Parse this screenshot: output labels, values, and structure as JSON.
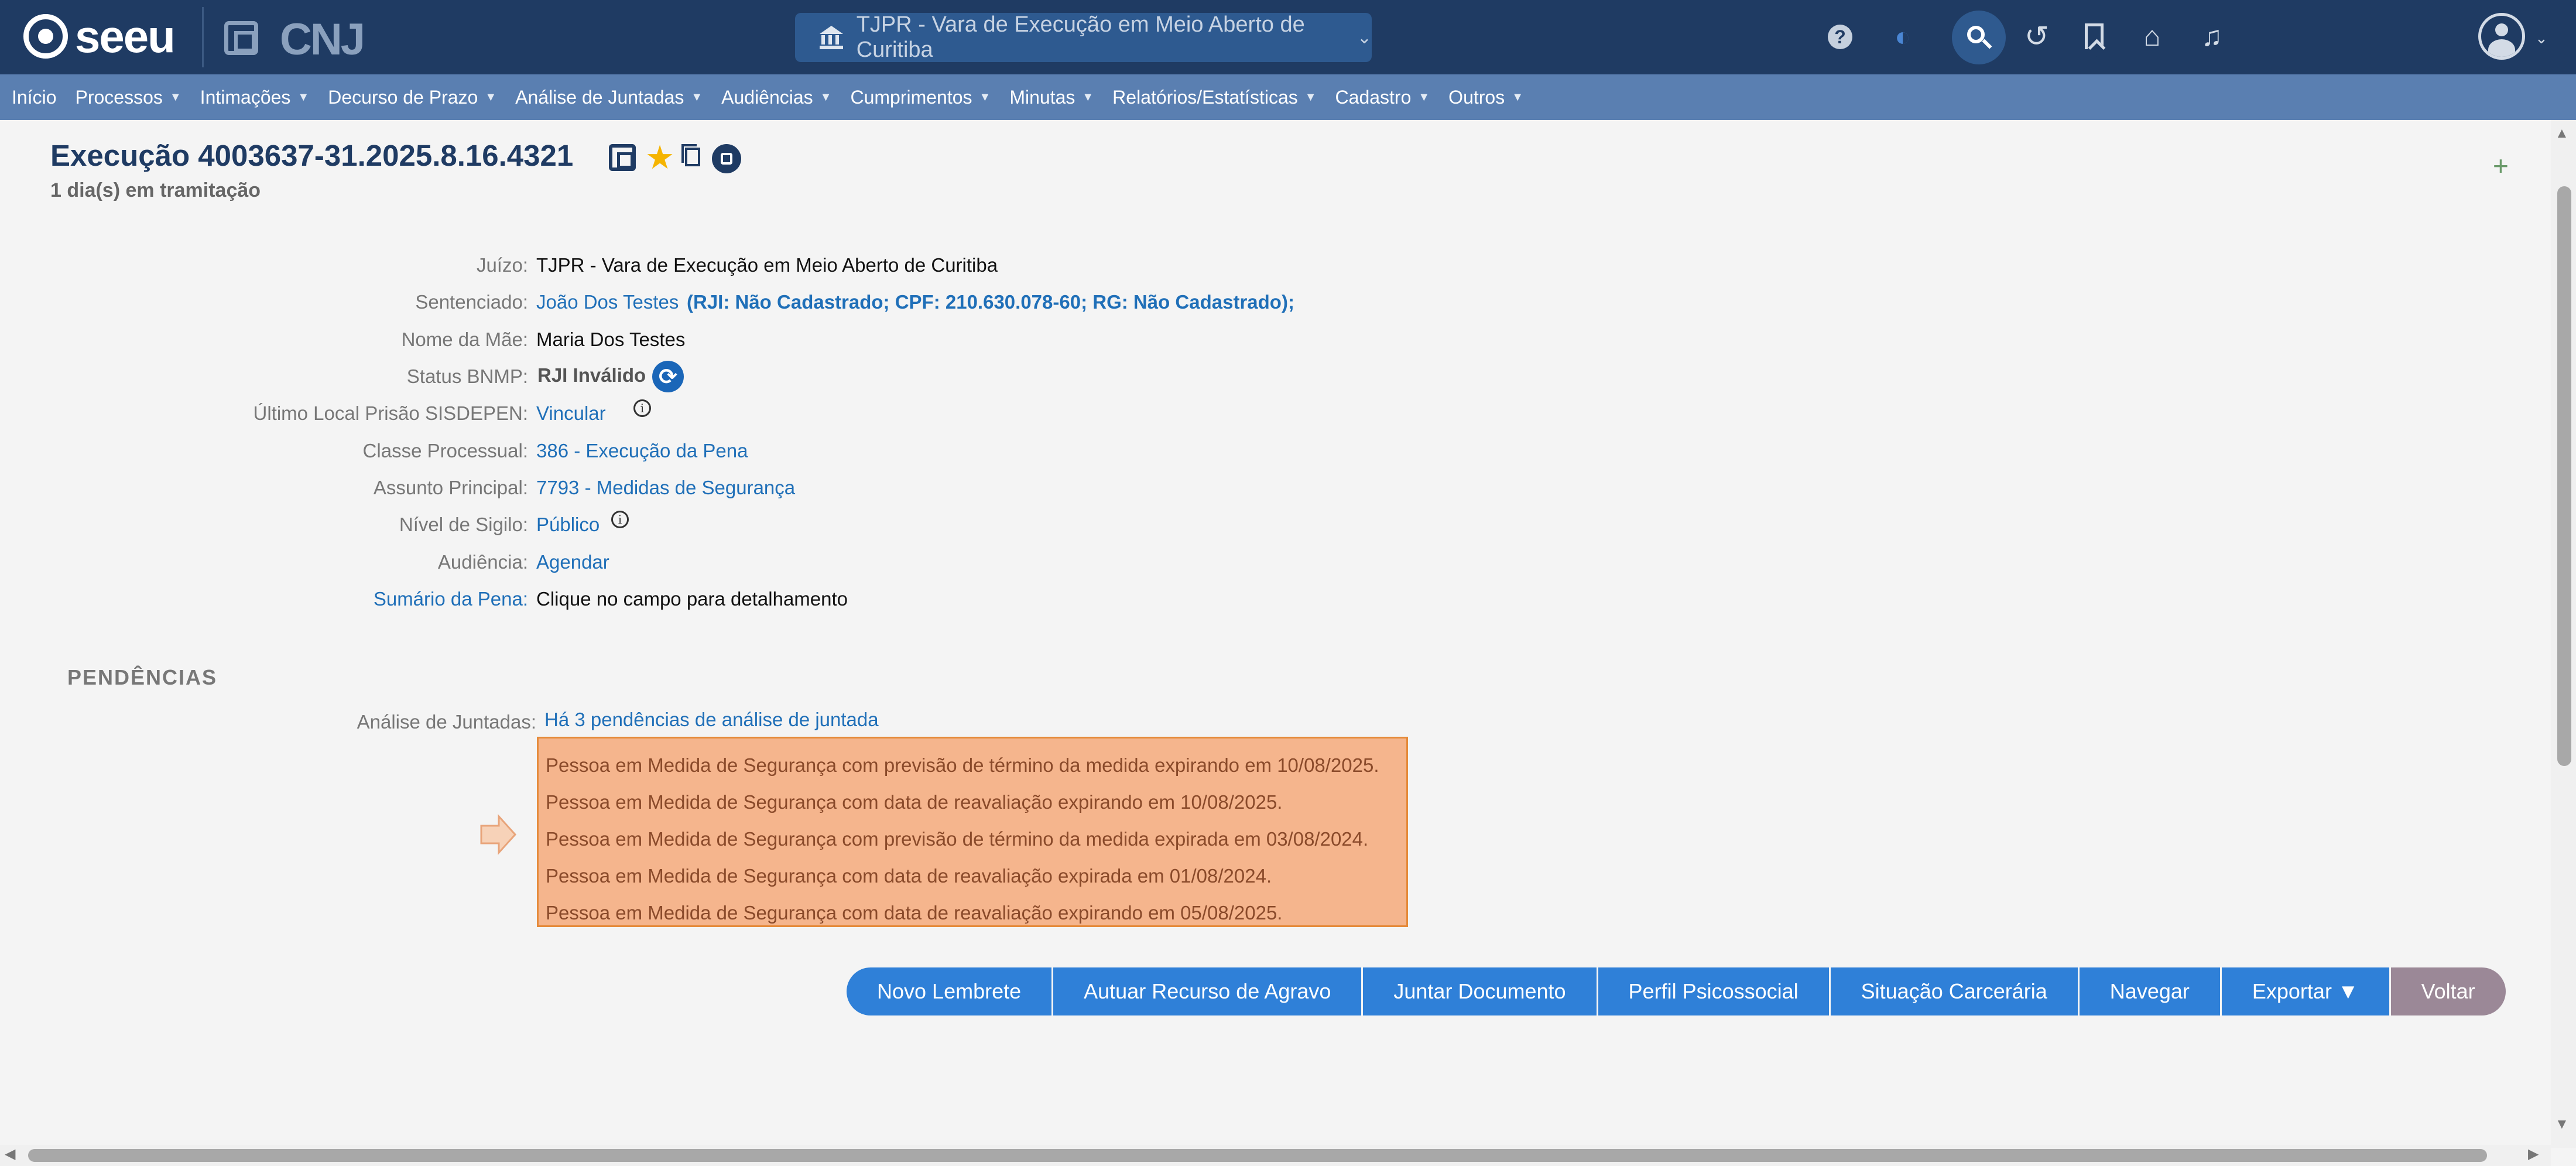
{
  "header": {
    "logo_text": "seeu",
    "cnj_text": "CNJ",
    "court_selector": "TJPR - Vara de Execução em Meio Aberto de Curitiba",
    "help_symbol": "?",
    "icons": [
      "help-icon",
      "theme-icon",
      "search-icon",
      "history-icon",
      "bookmark-icon",
      "tag-icon",
      "bell-icon",
      "user-avatar-icon"
    ]
  },
  "menu": {
    "items": [
      {
        "label": "Início",
        "has_caret": false
      },
      {
        "label": "Processos",
        "has_caret": true
      },
      {
        "label": "Intimações",
        "has_caret": true
      },
      {
        "label": "Decurso de Prazo",
        "has_caret": true
      },
      {
        "label": "Análise de Juntadas",
        "has_caret": true
      },
      {
        "label": "Audiências",
        "has_caret": true
      },
      {
        "label": "Cumprimentos",
        "has_caret": true
      },
      {
        "label": "Minutas",
        "has_caret": true
      },
      {
        "label": "Relatórios/Estatísticas",
        "has_caret": true
      },
      {
        "label": "Cadastro",
        "has_caret": true
      },
      {
        "label": "Outros",
        "has_caret": true
      }
    ]
  },
  "process": {
    "title": "Execução 4003637-31.2025.8.16.4321",
    "subtitle": "1 dia(s) em tramitação",
    "plus": "+"
  },
  "fields": {
    "juizo": {
      "label": "Juízo:",
      "value": "TJPR - Vara de Execução em Meio Aberto de Curitiba"
    },
    "sentenciado": {
      "label": "Sentenciado:",
      "name": "João Dos Testes",
      "details": "(RJI: Não Cadastrado; CPF: 210.630.078-60; RG: Não Cadastrado);"
    },
    "mae": {
      "label": "Nome da Mãe:",
      "value": "Maria Dos Testes"
    },
    "bnmp": {
      "label": "Status BNMP:",
      "value": "RJI Inválido"
    },
    "sisdepen": {
      "label": "Último Local Prisão SISDEPEN:",
      "value": "Vincular"
    },
    "classe": {
      "label": "Classe Processual:",
      "value": "386 - Execução da Pena"
    },
    "assunto": {
      "label": "Assunto Principal:",
      "value": "7793 - Medidas de Segurança"
    },
    "sigilo": {
      "label": "Nível de Sigilo:",
      "value": "Público"
    },
    "audiencia": {
      "label": "Audiência:",
      "value": "Agendar"
    },
    "sumario": {
      "label": "Sumário da Pena:",
      "value": "Clique no campo para detalhamento"
    }
  },
  "pendencias": {
    "title": "PENDÊNCIAS",
    "label": "Análise de Juntadas:",
    "link": "Há 3 pendências de análise de juntada",
    "alerts": [
      "Pessoa em Medida de Segurança com previsão de término da medida expirando em 10/08/2025.",
      "Pessoa em Medida de Segurança com data de reavaliação expirando em 10/08/2025.",
      "Pessoa em Medida de Segurança com previsão de término da medida expirada em 03/08/2024.",
      "Pessoa em Medida de Segurança com data de reavaliação expirada em 01/08/2024.",
      "Pessoa em Medida de Segurança com data de reavaliação expirando em 05/08/2025."
    ]
  },
  "actions": {
    "novo_lembrete": "Novo Lembrete",
    "autuar_recurso": "Autuar Recurso de Agravo",
    "juntar_documento": "Juntar Documento",
    "perfil_psicossocial": "Perfil Psicossocial",
    "situacao_carceraria": "Situação Carcerária",
    "navegar": "Navegar",
    "exportar": "Exportar ▼",
    "voltar": "Voltar"
  },
  "colors": {
    "header_bg": "#1f3b63",
    "menu_bg": "#5a7fb1",
    "link": "#1f6fb8",
    "alert_bg": "#f5b58d",
    "alert_border": "#e58a3a",
    "button": "#2f80d8",
    "button_back": "#9b8897"
  }
}
